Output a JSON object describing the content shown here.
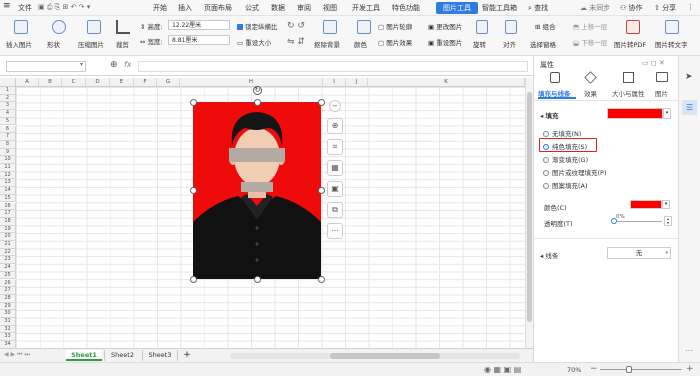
{
  "menu": {
    "hamburger": "≡",
    "file": "文件",
    "items": [
      "开始",
      "插入",
      "页面布局",
      "公式",
      "数据",
      "审阅",
      "视图",
      "开发工具",
      "特色功能"
    ],
    "active_tab": "图片工具",
    "extra_tab": "智能工具箱",
    "search": "查找",
    "sync": "未同步",
    "collab": "协作",
    "share": "分享"
  },
  "ribbon": {
    "insert_picture": "插入图片",
    "shape": "形状",
    "compress": "压缩图片",
    "crop": "裁剪",
    "height_label": "高度:",
    "height_value": "12.22厘米",
    "width_label": "宽度:",
    "width_value": "8.81厘米",
    "lock_ratio": "锁定纵横比",
    "reset_size": "重设大小",
    "remove_bg": "抠除背景",
    "color": "颜色",
    "outline": "图片轮廓",
    "effect": "图片效果",
    "change_pic": "更改图片",
    "reset_pic": "重设图片",
    "rotate": "旋转",
    "align": "对齐",
    "group": "组合",
    "up_layer": "上移一层",
    "down_layer": "下移一层",
    "select_pane": "选择窗格",
    "to_pdf": "图片转PDF",
    "to_text": "图片转文字"
  },
  "formula": {
    "fx": "fx",
    "zoom_icon": "magnifier"
  },
  "columns": [
    "A",
    "B",
    "C",
    "D",
    "E",
    "F",
    "G",
    "H",
    "I",
    "J",
    "K"
  ],
  "rows": [
    "1",
    "2",
    "3",
    "4",
    "5",
    "6",
    "7",
    "8",
    "9",
    "10",
    "11",
    "12",
    "13",
    "14",
    "15",
    "16",
    "17",
    "18",
    "19",
    "20",
    "21",
    "22",
    "23",
    "24",
    "25",
    "26",
    "27",
    "28",
    "29",
    "30",
    "31",
    "32",
    "33",
    "34"
  ],
  "floatbar": {
    "minus": "−",
    "zoom": "⊕",
    "crop": "⌗",
    "fit": "▦",
    "img": "▣",
    "copy": "⧉",
    "more": "⋯"
  },
  "sheets": [
    "Sheet1",
    "Sheet2",
    "Sheet3"
  ],
  "add_sheet": "+",
  "status": {
    "zoom_value": "70%",
    "zoom_minus": "−",
    "zoom_plus": "+"
  },
  "panel": {
    "title": "属性",
    "tabs": [
      "填充与线条",
      "效果",
      "大小与属性",
      "图片"
    ],
    "fill_section": "填充",
    "fill_color": "#ff0000",
    "options": [
      "无填充(N)",
      "纯色填充(S)",
      "渐变填充(G)",
      "图片或纹理填充(P)",
      "图案填充(A)"
    ],
    "selected_option": "纯色填充(S)",
    "color_label": "颜色(C)",
    "transparency_label": "透明度(T)",
    "transparency_value": "0%",
    "line_section": "线条",
    "line_value": "无"
  },
  "colors": {
    "accent": "#2f7be0",
    "photo_bg": "#f00b0b",
    "highlight": "#e02020"
  }
}
